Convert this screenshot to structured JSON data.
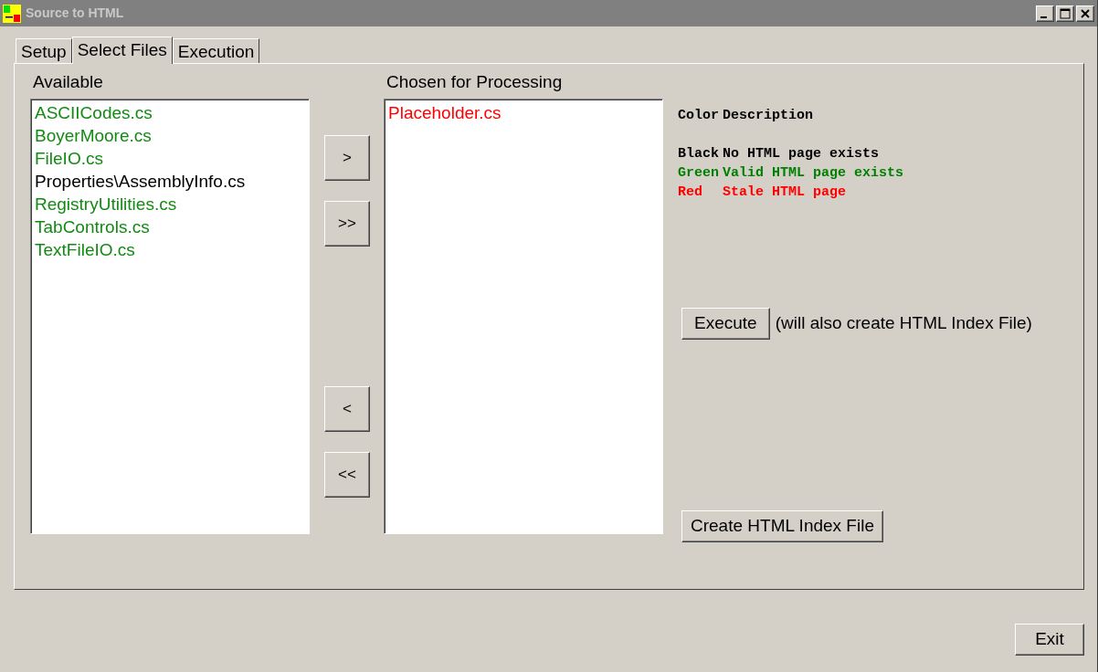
{
  "window": {
    "title": "Source to HTML"
  },
  "tabs": [
    {
      "label": "Setup",
      "selected": false
    },
    {
      "label": "Select Files",
      "selected": true
    },
    {
      "label": "Execution",
      "selected": false
    }
  ],
  "available": {
    "label": "Available",
    "items": [
      {
        "name": "ASCIICodes.cs",
        "color": "#138a13"
      },
      {
        "name": "BoyerMoore.cs",
        "color": "#138a13"
      },
      {
        "name": "FileIO.cs",
        "color": "#138a13"
      },
      {
        "name": "Properties\\AssemblyInfo.cs",
        "color": "#000000"
      },
      {
        "name": "RegistryUtilities.cs",
        "color": "#138a13"
      },
      {
        "name": "TabControls.cs",
        "color": "#138a13"
      },
      {
        "name": "TextFileIO.cs",
        "color": "#138a13"
      }
    ]
  },
  "move_buttons": [
    ">",
    ">>",
    "<",
    "<<"
  ],
  "chosen": {
    "label": "Chosen for Processing",
    "items": [
      {
        "name": "Placeholder.cs",
        "color": "#ff0000"
      }
    ]
  },
  "legend": {
    "headers": [
      "Color",
      "Description"
    ],
    "rows": [
      {
        "name": "Black",
        "description": "No HTML page exists",
        "color": "#000000"
      },
      {
        "name": "Green",
        "description": "Valid HTML page exists",
        "color": "#008000"
      },
      {
        "name": "Red",
        "description": "Stale HTML page",
        "color": "#ff0000"
      }
    ]
  },
  "execute_button": "Execute",
  "execute_note": "(will also create HTML Index File)",
  "index_button": "Create HTML Index File",
  "exit_button": "Exit"
}
